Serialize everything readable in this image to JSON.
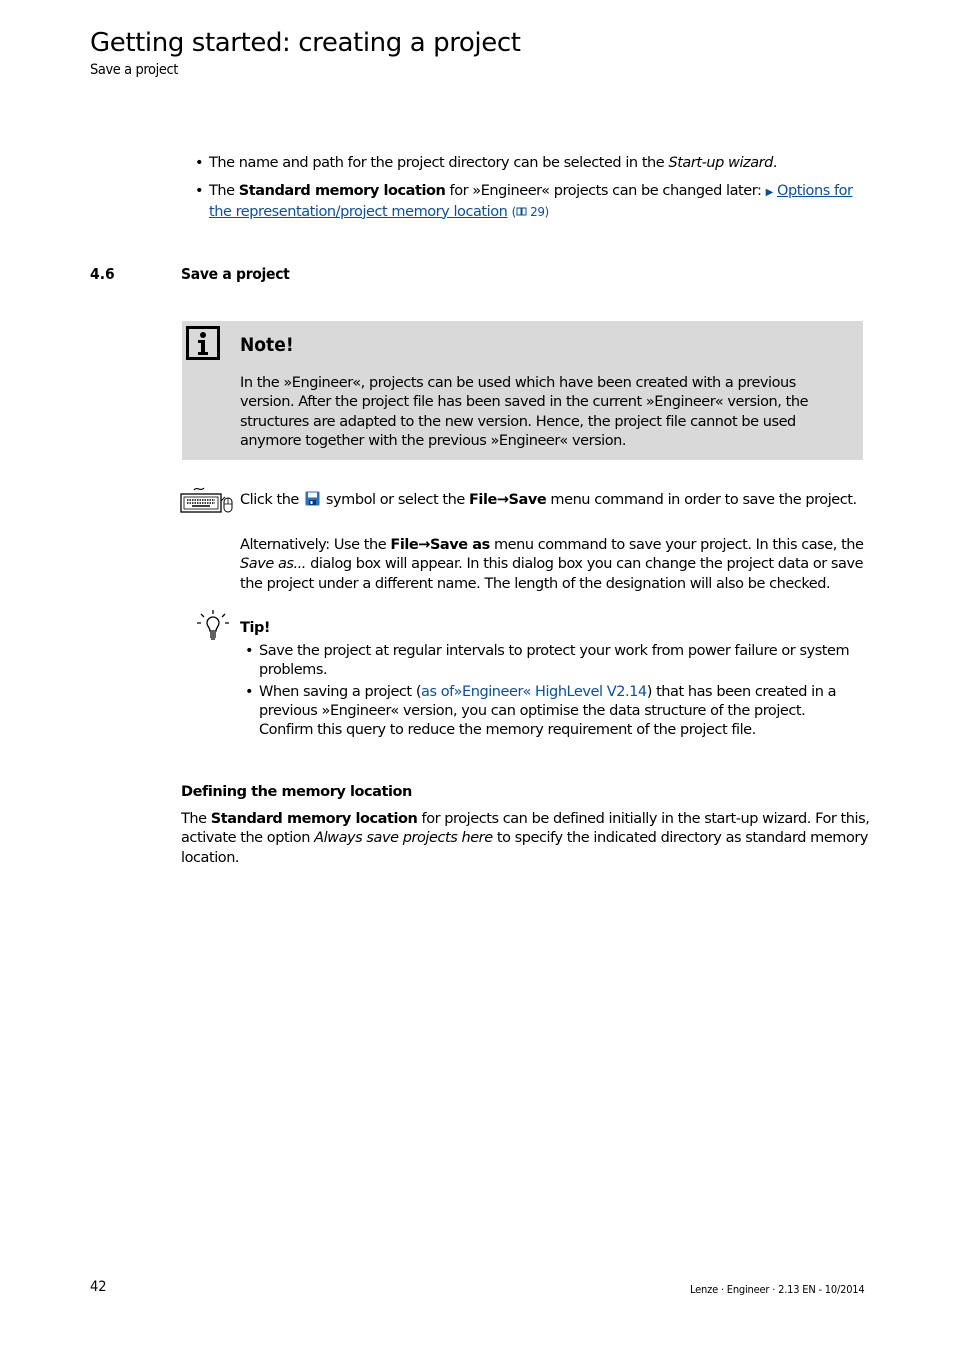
{
  "header": {
    "title": "Getting started: creating a project",
    "subtitle": "Save a project",
    "separator": "_ _ _ _ _ _ _ _ _ _ _ _ _ _ _ _ _ _ _ _ _ _ _ _ _ _ _ _ _ _ _ _ _ _ _ _ _ _ _ _ _ _ _ _ _ _ _ _ _ _ _ _ _ _ _ _ _ _ _ _ _ _ _ _ _ _ _ _ _ _"
  },
  "intro_bullets": {
    "b1_text": "The name and path for the project directory can be selected in the ",
    "b1_italic": "Start-up wizard",
    "b1_end": ".",
    "b2_pre": "The ",
    "b2_bold": "Standard memory location",
    "b2_mid": " for »Engineer« projects can be changed later: ",
    "b2_link": "Options for the representation/project memory location",
    "b2_ref": "(🕮 29)"
  },
  "section": {
    "number": "4.6",
    "title": "Save a project"
  },
  "note": {
    "title": "Note!",
    "body": "In the »Engineer«, projects can be used which have been created with a previous version. After the project file has been saved in the current »Engineer« version, the structures are adapted to the new version. Hence, the project file cannot be used anymore together with the previous »Engineer« version."
  },
  "instruction": {
    "p1_pre": "Click the",
    "p1_mid": "symbol or select the ",
    "p1_cmd": "File→Save",
    "p1_post": " menu command in order to save the project.",
    "p2_pre": "Alternatively: Use the ",
    "p2_cmd": "File→Save as",
    "p2_mid": " menu command to save your project. In this case, the ",
    "p2_italic": "Save as...",
    "p2_post": " dialog box will appear. In this dialog box you can change the project data or save the project under a different name. The length of the designation will also be checked."
  },
  "tip": {
    "title": "Tip!",
    "item1": "Save the project at regular intervals to protect your work from power failure or system problems.",
    "item2_pre": "When saving a project (",
    "item2_blue": "as of»Engineer« HighLevel V2.14",
    "item2_post": ") that has been created in a previous »Engineer« version, you can optimise the data structure of the project. Confirm this query to reduce the memory requirement of the project file."
  },
  "memory": {
    "heading": "Defining the memory location",
    "pre": "The ",
    "bold": "Standard memory location",
    "mid": " for projects can be defined initially in the start-up wizard. For this, activate the option ",
    "italic": "Always save projects here",
    "post": " to specify the indicated directory as standard memory location."
  },
  "footer": {
    "page_number": "42",
    "doc_info": "Lenze · Engineer · 2.13 EN - 10/2014"
  },
  "colors": {
    "link": "#0a4f9c",
    "note_bg": "#d9d9d9"
  }
}
